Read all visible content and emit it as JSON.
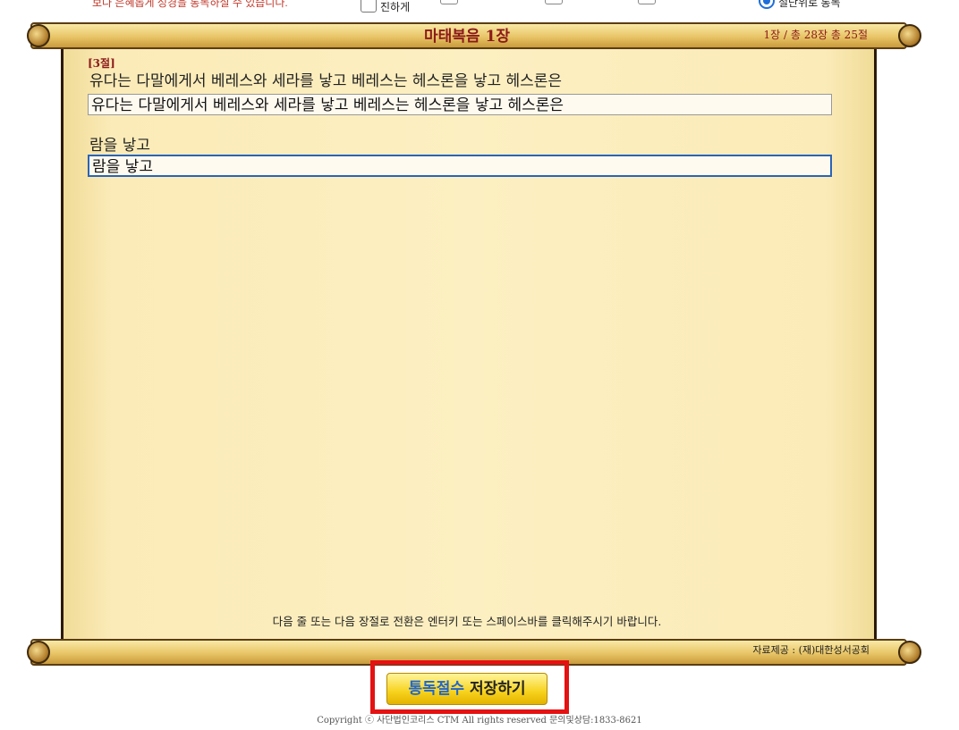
{
  "top": {
    "notice": "보다 은혜롭게 성경을 통독하실 수 있습니다.",
    "checkbox_label": "진하게",
    "radio_label": "절단위로 통독"
  },
  "scroll": {
    "chapter_title": "마태복음 1장",
    "chapter_count": "1장 / 총 28장   총 25절",
    "copyright_label": "자료제공 : (재)대한성서공회",
    "verse_label": "[3절]",
    "reference_line_1": "유다는 다말에게서 베레스와 세라를 낳고 베레스는 헤스론을 낳고 헤스론은",
    "typed_line_1": "유다는 다말에게서 베레스와 세라를 낳고 베레스는 헤스론을 낳고 헤스론은",
    "reference_line_2": "람을 낳고",
    "typed_line_2_prefix": "람을 낳",
    "typed_line_2_active": "고",
    "help_text": "다음 줄 또는 다음 장절로 전환은 엔터키 또는 스페이스바를 클릭해주시기 바랍니다."
  },
  "save_button": {
    "label_part1": "통독절수",
    "label_part2": " 저장하기"
  },
  "footer": {
    "copyright": "Copyright ⓒ 사단법인코리스 CTM All rights reserved 문의및상담:1833-8621"
  },
  "colors": {
    "title_red": "#8b1a1a",
    "highlight_red": "#e41212",
    "button_yellow": "#f7d21c",
    "button_blue_text": "#2266cc"
  }
}
